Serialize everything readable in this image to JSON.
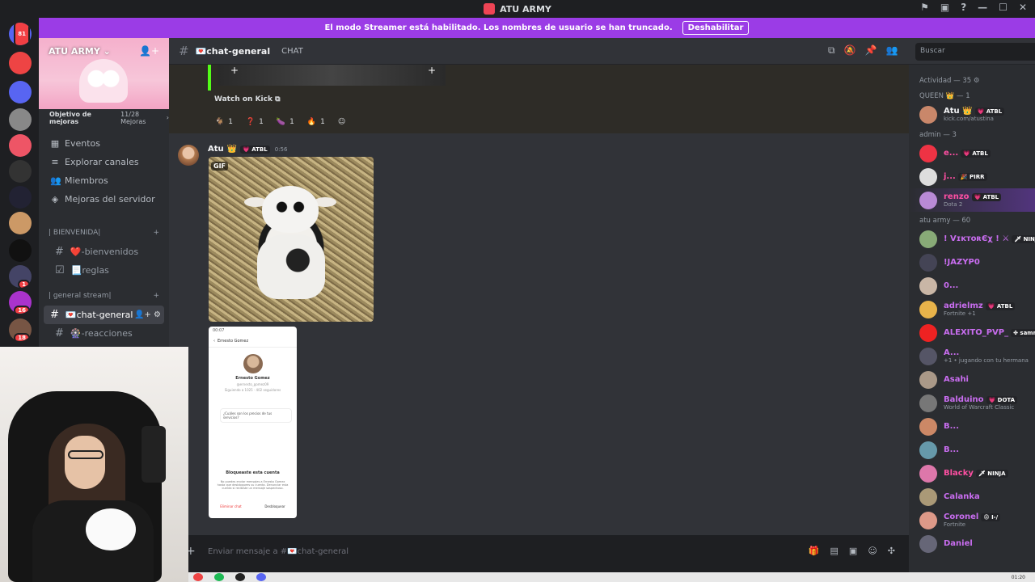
{
  "window": {
    "title": "ATU ARMY",
    "controls": [
      "⚑",
      "▣",
      "?",
      "—",
      "☐",
      "✕"
    ]
  },
  "banner": {
    "text": "El modo Streamer está habilitado. Los nombres de usuario se han truncado.",
    "button": "Deshabilitar"
  },
  "rail": {
    "badges": [
      "81",
      "1",
      "16",
      "18"
    ]
  },
  "server": {
    "name": "ATU ARMY",
    "invite_icon": "add-member-icon",
    "boost_label": "Objetivo de mejoras",
    "boost_count": "11/28 Mejoras",
    "nav": [
      {
        "icon": "calendar-icon",
        "label": "Eventos"
      },
      {
        "icon": "compass-icon",
        "label": "Explorar canales"
      },
      {
        "icon": "members-icon",
        "label": "Miembros"
      },
      {
        "icon": "boost-icon",
        "label": "Mejoras del servidor"
      }
    ],
    "categories": [
      {
        "label": "| BIENVENIDA|",
        "channels": [
          {
            "label": "❤️-bienvenidos"
          },
          {
            "label": "📃reglas"
          }
        ]
      },
      {
        "label": "| general stream|",
        "channels": [
          {
            "label": "💌chat-general"
          },
          {
            "label": "🎡-reacciones"
          }
        ]
      }
    ]
  },
  "channel": {
    "name": "💌chat-general",
    "tag": "CHAT",
    "search_placeholder": "Buscar"
  },
  "embed": {
    "link": "Watch on Kick",
    "reactions": [
      {
        "emoji": "🐐",
        "count": "1"
      },
      {
        "emoji": "❓",
        "count": "1"
      },
      {
        "emoji": "🍆",
        "count": "1"
      },
      {
        "emoji": "🔥",
        "count": "1"
      }
    ]
  },
  "message": {
    "author": "Atu",
    "crown": "👑",
    "tag": "💗 ATBL",
    "time": "0:56",
    "gif_label": "GIF",
    "screenshot": {
      "status": "00:07",
      "top_name": "Ernesto Gomez",
      "name": "Ernesto Gomez",
      "handle": "@ernesto_gomez09",
      "stats": "Siguiendo a 1025 · 402 seguidores",
      "question": "¿Cuáles son los precios de tus servicios?",
      "block_title": "Bloqueaste esta cuenta",
      "block_text": "No puedes enviar mensajes a Ernesto Gomez hasta que desbloquees su cuenta. Denunciar esta cuenta si recibiste un mensaje sospechoso.",
      "btn_left": "Eliminar chat",
      "btn_right": "Desbloquear"
    }
  },
  "composer": {
    "placeholder": "Enviar mensaje a #💌chat-general"
  },
  "members": {
    "activity": "Actividad — 35",
    "groups": [
      {
        "label": "QUEEN 👑 — 1",
        "items": [
          {
            "name": "Atu 👑",
            "tag": "💗 ATBL",
            "status": "kick.com/atustina",
            "color": "#f2f3f5",
            "av": "#c9876a"
          }
        ]
      },
      {
        "label": "admin — 3",
        "items": [
          {
            "name": "e...",
            "tag": "💗 ATBL",
            "status": "",
            "color": "#ff4fa3",
            "av": "#e34"
          },
          {
            "name": "j...",
            "tag": "🎉 PIRR",
            "status": "",
            "color": "#ff4fa3",
            "av": "#ddd"
          },
          {
            "name": "renzo",
            "tag": "💗 ATBL",
            "status": "Dota 2",
            "color": "#ff4fa3",
            "av": "#b98ad6"
          }
        ]
      },
      {
        "label": "atu army — 60",
        "items": [
          {
            "name": "! VɪᴋᴛᴏʀЄχ ! ⚔",
            "tag": "🗡 NINJA",
            "status": "",
            "color": "#c96df0",
            "av": "#8a7"
          },
          {
            "name": "!JAZYP0",
            "tag": "",
            "status": "",
            "color": "#c96df0",
            "av": "#445"
          },
          {
            "name": "0...",
            "tag": "",
            "status": "",
            "color": "#c96df0",
            "av": "#c9b6a6"
          },
          {
            "name": "adrielmz",
            "tag": "💗 ATBL",
            "status": "Fortnite +1",
            "color": "#c96df0",
            "av": "#e8b34a"
          },
          {
            "name": "ALEXITO_PVP_",
            "tag": "✤ sammy",
            "status": "",
            "color": "#c96df0",
            "av": "#e22"
          },
          {
            "name": "A...",
            "tag": "",
            "status": "+1 • jugando con tu hermana",
            "color": "#c96df0",
            "av": "#556"
          },
          {
            "name": "Asahi",
            "tag": "",
            "status": "",
            "color": "#c96df0",
            "av": "#a98"
          },
          {
            "name": "Balduino",
            "tag": "💗 DOTA",
            "status": "World of Warcraft Classic",
            "color": "#c96df0",
            "av": "#777"
          },
          {
            "name": "B...",
            "tag": "",
            "status": "",
            "color": "#c96df0",
            "av": "#c86"
          },
          {
            "name": "B...",
            "tag": "",
            "status": "",
            "color": "#c96df0",
            "av": "#69a"
          },
          {
            "name": "Blacky",
            "tag": "🗡 NINJA",
            "status": "",
            "color": "#ff4fa3",
            "av": "#d7a"
          },
          {
            "name": "Calanka",
            "tag": "",
            "status": "",
            "color": "#c96df0",
            "av": "#a97"
          },
          {
            "name": "Coronel",
            "tag": "😡 I-/",
            "status": "Fortnite",
            "color": "#c96df0",
            "av": "#d98"
          },
          {
            "name": "Daniel",
            "tag": "",
            "status": "",
            "color": "#c96df0",
            "av": "#667"
          }
        ]
      }
    ]
  },
  "taskbar": {
    "clock": "01:20"
  }
}
